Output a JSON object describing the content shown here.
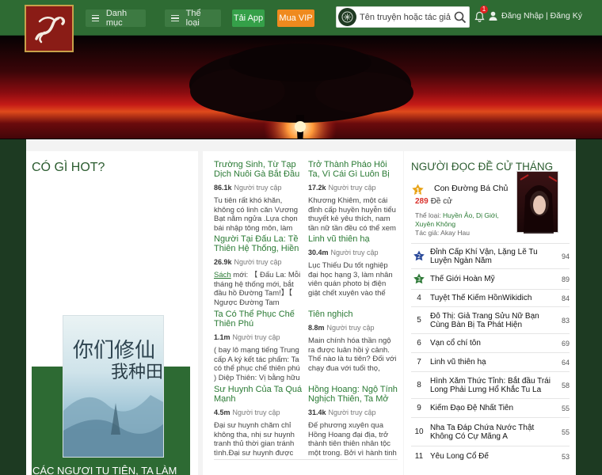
{
  "header": {
    "menu_label": "Danh mục",
    "genre_label": "Thể loại",
    "app_label": "Tải App",
    "vip_label": "Mua VIP",
    "search_placeholder": "Tên truyện hoặc tác giả",
    "notification_count": "1",
    "auth_label": "Đăng Nhập | Đăng Ký"
  },
  "hot": {
    "title": "CÓ GÌ HOT?",
    "cover_caption": "CÁC NGƯƠI TU TIÊN, TA LÀM"
  },
  "stories": [
    {
      "title": "Trường Sinh, Từ Tạp Dịch Nuôi Gà Bắt Đầu",
      "views": "86.1k",
      "views_label": "Người truy cập",
      "desc": "Tu tiên rất khó khăn, không có linh căn Vương Bạt nằm ngửa .Lựa chọn bái nhập tông môn, làm một"
    },
    {
      "title": "Trở Thành Pháo Hôi Ta, Vì Cái Gì Luôn Bị",
      "views": "17.2k",
      "views_label": "Người truy cập",
      "desc": "Khương Khiêm, một cái đỉnh cấp huyền huyễn tiểu thuyết kẻ yêu thích, nam tần nữ tần đều có thể xem"
    },
    {
      "title": "Người Tại Đấu La: Tề Thiên Hệ Thống, Hiền",
      "views": "26.9k",
      "views_label": "Người truy cập",
      "desc_link": "Sách",
      "desc": " mới: 【 Đấu La: Mỗi tháng hệ thống mới, bắt đầu hồ Đường Tam!】【 Ngược Đường Tam"
    },
    {
      "title": "Linh vũ thiên hạ",
      "views": "30.4m",
      "views_label": "Người truy cập",
      "desc": "Lục Thiếu Du tốt nghiệp đại học hạng 3, làm nhân viên quán photo bị điện giật chết xuyên vào thế"
    },
    {
      "title": "Ta Có Thể Phục Chế Thiên Phú",
      "views": "1.1m",
      "views_label": "Người truy cập",
      "desc": "( bay lô mạng tiếng Trung cấp A ký kết tác phẩm: Ta có thể phục chế thiên phú ) Diệp Thiên: Vị bằng hữu"
    },
    {
      "title": "Tiên nghịch",
      "views": "8.8m",
      "views_label": "Người truy cập",
      "desc": "Main chính hóa thần ngộ ra được luân hồi ý cảnh. Thế nào là tu tiên? Đối với chạy đua với tuổi thọ,"
    },
    {
      "title": "Sư Huynh Của Ta Quá Mạnh",
      "views": "4.5m",
      "views_label": "Người truy cập",
      "desc": "Đại sư huynh chăm chỉ không tha, nhị sư huynh tranh thủ thời gian tránh tình.Đại sư huynh được"
    },
    {
      "title": "Hồng Hoang: Ngộ Tính Nghịch Thiên, Ta Mở",
      "views": "31.4k",
      "views_label": "Người truy cập",
      "desc": "Đế phương xuyên qua Hồng Hoang đại địa, trở thành tiên thiên nhân tộc một trong. Bởi vì hành tinh"
    }
  ],
  "ranking": {
    "title": "NGƯỜI ĐỌC ĐỀ CỬ THÁNG",
    "top": {
      "rank": "1",
      "name": "Con Đường Bá Chủ",
      "votes": "289",
      "votes_label": "Đề cử",
      "genre_label": "Thể loại:",
      "genre": "Huyền Ảo, Dị Giới, Xuyên Không",
      "author_label": "Tác giả:",
      "author": "Akay Hau"
    },
    "items": [
      {
        "rank": "2",
        "name": "Đỉnh Cấp Khí Vận, Lặng Lẽ Tu Luyện Ngàn Năm",
        "count": "94"
      },
      {
        "rank": "3",
        "name": "Thế Giới Hoàn Mỹ",
        "count": "89"
      },
      {
        "rank": "4",
        "name": "Tuyệt Thế Kiếm HồnWikidich",
        "count": "84"
      },
      {
        "rank": "5",
        "name": "Đô Thị: Giả Trang Sửu Nữ Bạn Cùng Bàn Bị Ta Phát Hiện",
        "count": "83"
      },
      {
        "rank": "6",
        "name": "Vạn cổ chí tôn",
        "count": "69"
      },
      {
        "rank": "7",
        "name": "Linh vũ thiên hạ",
        "count": "64"
      },
      {
        "rank": "8",
        "name": "Hình Xăm Thức Tỉnh: Bắt đầu Trái Long Phải Lưng Hổ Khắc Tu La",
        "count": "58"
      },
      {
        "rank": "9",
        "name": "Kiếm Đạo Đệ Nhất Tiên",
        "count": "55"
      },
      {
        "rank": "10",
        "name": "Nha Ta Đáp Chứa Nước Thật Không Có Cự Mãng A",
        "count": "55"
      },
      {
        "rank": "11",
        "name": "Yêu Long Cổ Đế",
        "count": "53"
      }
    ]
  },
  "colors": {
    "header": "#2e6b33",
    "accent_green": "#2a7a34",
    "vip_orange": "#ef8a1e",
    "app_green": "#35a049",
    "votes_red": "#d9302b"
  }
}
